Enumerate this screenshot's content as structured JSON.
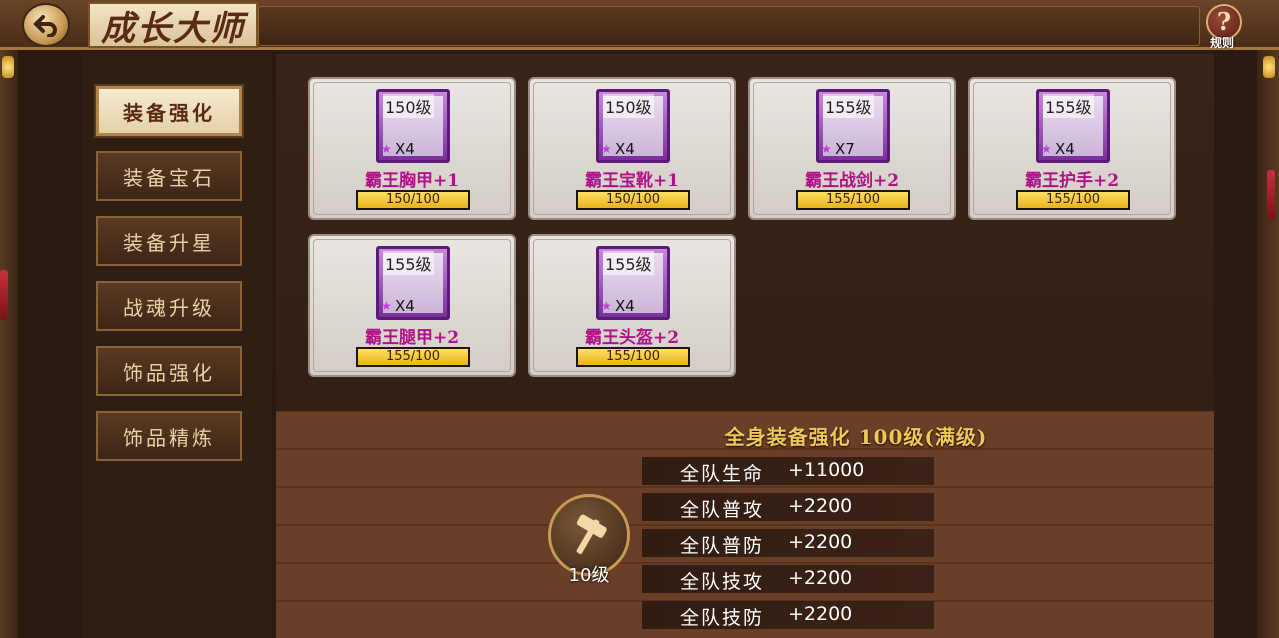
{
  "header": {
    "title": "成长大师",
    "rules_label": "规则"
  },
  "sidebar": {
    "items": [
      {
        "label": "装备强化",
        "active": true
      },
      {
        "label": "装备宝石"
      },
      {
        "label": "装备升星"
      },
      {
        "label": "战魂升级"
      },
      {
        "label": "饰品强化"
      },
      {
        "label": "饰品精炼"
      }
    ]
  },
  "equipment": [
    {
      "level": "150级",
      "qty": "X4",
      "name": "霸王胸甲+1",
      "progress": "150/100",
      "progress_fraction": 1.0,
      "icon": "armor-chest-icon"
    },
    {
      "level": "150级",
      "qty": "X4",
      "name": "霸王宝靴+1",
      "progress": "150/100",
      "progress_fraction": 1.0,
      "icon": "boots-icon"
    },
    {
      "level": "155级",
      "qty": "X7",
      "name": "霸王战剑+2",
      "progress": "155/100",
      "progress_fraction": 1.0,
      "icon": "sword-icon"
    },
    {
      "level": "155级",
      "qty": "X4",
      "name": "霸王护手+2",
      "progress": "155/100",
      "progress_fraction": 1.0,
      "icon": "gauntlet-icon"
    },
    {
      "level": "155级",
      "qty": "X4",
      "name": "霸王腿甲+2",
      "progress": "155/100",
      "progress_fraction": 1.0,
      "icon": "leg-armor-icon"
    },
    {
      "level": "155级",
      "qty": "X4",
      "name": "霸王头盔+2",
      "progress": "155/100",
      "progress_fraction": 1.0,
      "icon": "helmet-icon"
    }
  ],
  "bonus": {
    "title": "全身装备强化 100级(满级)",
    "master_level": "10级",
    "stats": [
      {
        "name": "全队生命",
        "value": "+11000"
      },
      {
        "name": "全队普攻",
        "value": "+2200"
      },
      {
        "name": "全队普防",
        "value": "+2200"
      },
      {
        "name": "全队技攻",
        "value": "+2200"
      },
      {
        "name": "全队技防",
        "value": "+2200"
      }
    ]
  },
  "colors": {
    "item_name": "#b11288",
    "bonus_title": "#f2c75a",
    "item_frame": "#7a2f9a"
  }
}
